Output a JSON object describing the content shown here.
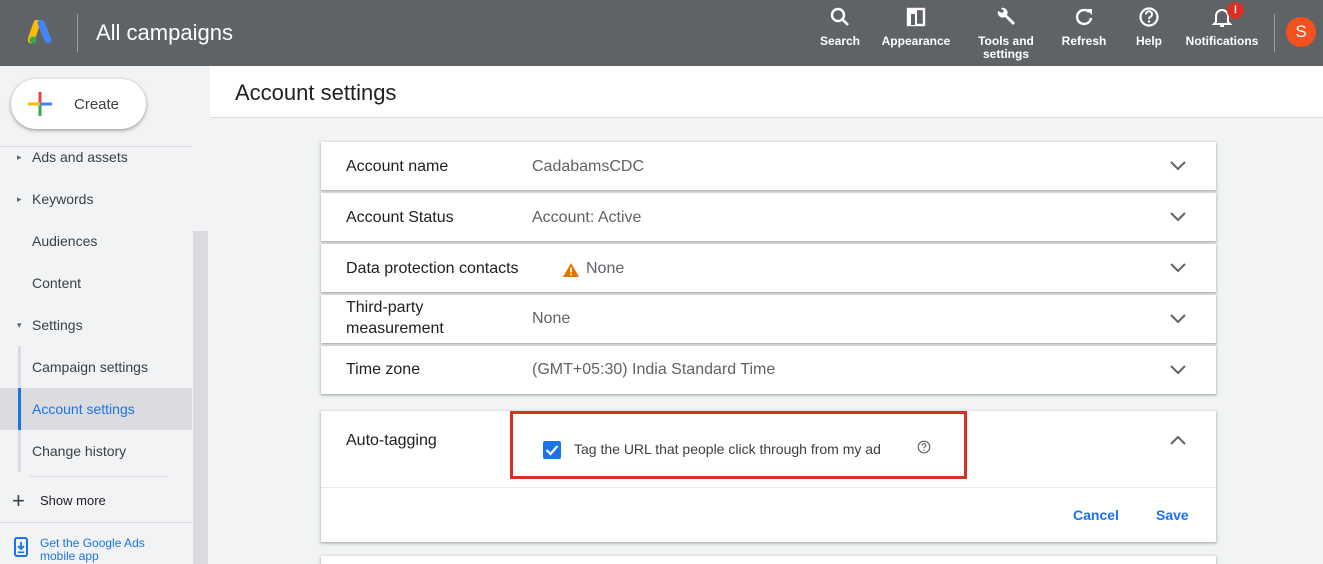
{
  "header": {
    "app_title": "All campaigns",
    "tools": [
      {
        "label": "Search",
        "icon": "search-icon"
      },
      {
        "label": "Appearance",
        "icon": "appearance-icon"
      },
      {
        "label": "Tools and\nsettings",
        "icon": "wrench-icon"
      },
      {
        "label": "Refresh",
        "icon": "refresh-icon"
      },
      {
        "label": "Help",
        "icon": "help-icon"
      },
      {
        "label": "Notifications",
        "icon": "bell-icon",
        "badge": "!"
      }
    ],
    "avatar_letter": "S"
  },
  "sidebar": {
    "create_label": "Create",
    "items": [
      {
        "label": "Ads and assets",
        "caret": "▸"
      },
      {
        "label": "Keywords",
        "caret": "▸"
      },
      {
        "label": "Audiences"
      },
      {
        "label": "Content"
      },
      {
        "label": "Settings",
        "caret": "▾"
      },
      {
        "label": "Campaign settings"
      },
      {
        "label": "Account settings"
      },
      {
        "label": "Change history"
      }
    ],
    "show_more": "Show more",
    "get_app": "Get the Google Ads mobile app"
  },
  "main": {
    "page_title": "Account settings",
    "rows": [
      {
        "label": "Account name",
        "value": "CadabamsCDC"
      },
      {
        "label": "Account Status",
        "value": "Account: Active"
      },
      {
        "label": "Data protection contacts",
        "value": "None"
      },
      {
        "label": "Third-party measurement",
        "value": "None"
      },
      {
        "label": "Time zone",
        "value": "(GMT+05:30) India Standard Time"
      }
    ],
    "auto_tagging": {
      "label": "Auto-tagging",
      "checkbox_label": "Tag the URL that people click through from my ad",
      "checked": true,
      "cancel": "Cancel",
      "save": "Save"
    }
  },
  "colors": {
    "header_bg": "#5f6368",
    "accent": "#1a73e8",
    "highlight": "#d93025",
    "warning": "#e37400",
    "avatar": "#f4511e"
  }
}
